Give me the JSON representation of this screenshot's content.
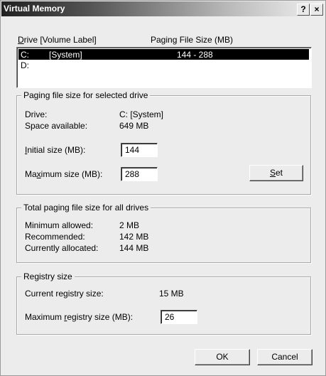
{
  "window": {
    "title": "Virtual Memory",
    "help_glyph": "?",
    "close_glyph": "×"
  },
  "drives": {
    "header": {
      "drive_prefix": "D",
      "drive_rest": "rive  [Volume Label]",
      "paging_size": "Paging File Size (MB)"
    },
    "rows": [
      {
        "drive": "C:",
        "label": "[System]",
        "size": "144 - 288",
        "selected": true
      },
      {
        "drive": "D:",
        "label": "",
        "size": "",
        "selected": false
      }
    ]
  },
  "selected_drive": {
    "legend": "Paging file size for selected drive",
    "drive_label": "Drive:",
    "drive_value": "C:  [System]",
    "space_label": "Space available:",
    "space_value": "649 MB",
    "initial": {
      "prefix": "",
      "mnemonic": "I",
      "suffix": "nitial size (MB):",
      "value": "144"
    },
    "maximum": {
      "prefix": "Ma",
      "mnemonic": "x",
      "suffix": "imum size (MB):",
      "value": "288"
    },
    "set_button": {
      "prefix": "",
      "mnemonic": "S",
      "suffix": "et"
    }
  },
  "total": {
    "legend": "Total paging file size for all drives",
    "min_label": "Minimum allowed:",
    "min_value": "2 MB",
    "rec_label": "Recommended:",
    "rec_value": "142 MB",
    "cur_label": "Currently allocated:",
    "cur_value": "144 MB"
  },
  "registry": {
    "legend": "Registry size",
    "current_label": "Current registry size:",
    "current_value": "15 MB",
    "max": {
      "prefix": "Maximum ",
      "mnemonic": "r",
      "suffix": "egistry size (MB):",
      "value": "26"
    }
  },
  "buttons": {
    "ok": "OK",
    "cancel": "Cancel"
  }
}
